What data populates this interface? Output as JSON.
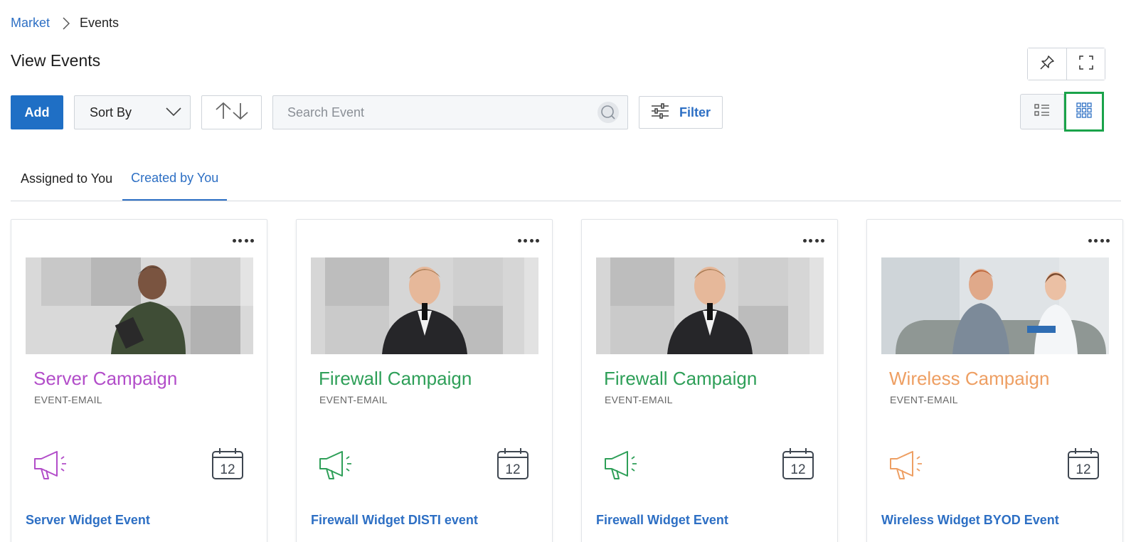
{
  "breadcrumb": {
    "parent": "Market",
    "current": "Events"
  },
  "page": {
    "title": "View Events"
  },
  "toolbar": {
    "add_label": "Add",
    "sort_label": "Sort By",
    "search_placeholder": "Search Event",
    "filter_label": "Filter"
  },
  "tabs": [
    {
      "label": "Assigned to You",
      "active": false
    },
    {
      "label": "Created by You",
      "active": true
    }
  ],
  "cards": [
    {
      "name": "Server Campaign",
      "type": "EVENT-EMAIL",
      "link": "Server Widget Event",
      "accent": "#b24dc9",
      "calendar_day": "12"
    },
    {
      "name": "Firewall Campaign",
      "type": "EVENT-EMAIL",
      "link": "Firewall Widget DISTI event",
      "accent": "#2e9f58",
      "calendar_day": "12"
    },
    {
      "name": "Firewall Campaign",
      "type": "EVENT-EMAIL",
      "link": "Firewall Widget Event",
      "accent": "#2e9f58",
      "calendar_day": "12"
    },
    {
      "name": "Wireless Campaign",
      "type": "EVENT-EMAIL",
      "link": "Wireless Widget BYOD Event",
      "accent": "#ee9f63",
      "calendar_day": "12"
    }
  ],
  "icons": {
    "breadcrumb_sep": "chevron-right-icon",
    "pin": "pin-icon",
    "fullscreen": "fullscreen-icon",
    "sort_dropdown": "chevron-down-icon",
    "sort_order": "sort-arrows-icon",
    "search": "search-icon",
    "filter": "sliders-icon",
    "list_view": "list-view-icon",
    "grid_view": "grid-view-icon",
    "card_more": "more-dots-icon",
    "card_channel": "megaphone-icon",
    "card_date": "calendar-icon"
  },
  "colors": {
    "primary": "#1f6fc5",
    "link": "#2d6fc4",
    "selected_outline": "#1aa34a"
  }
}
